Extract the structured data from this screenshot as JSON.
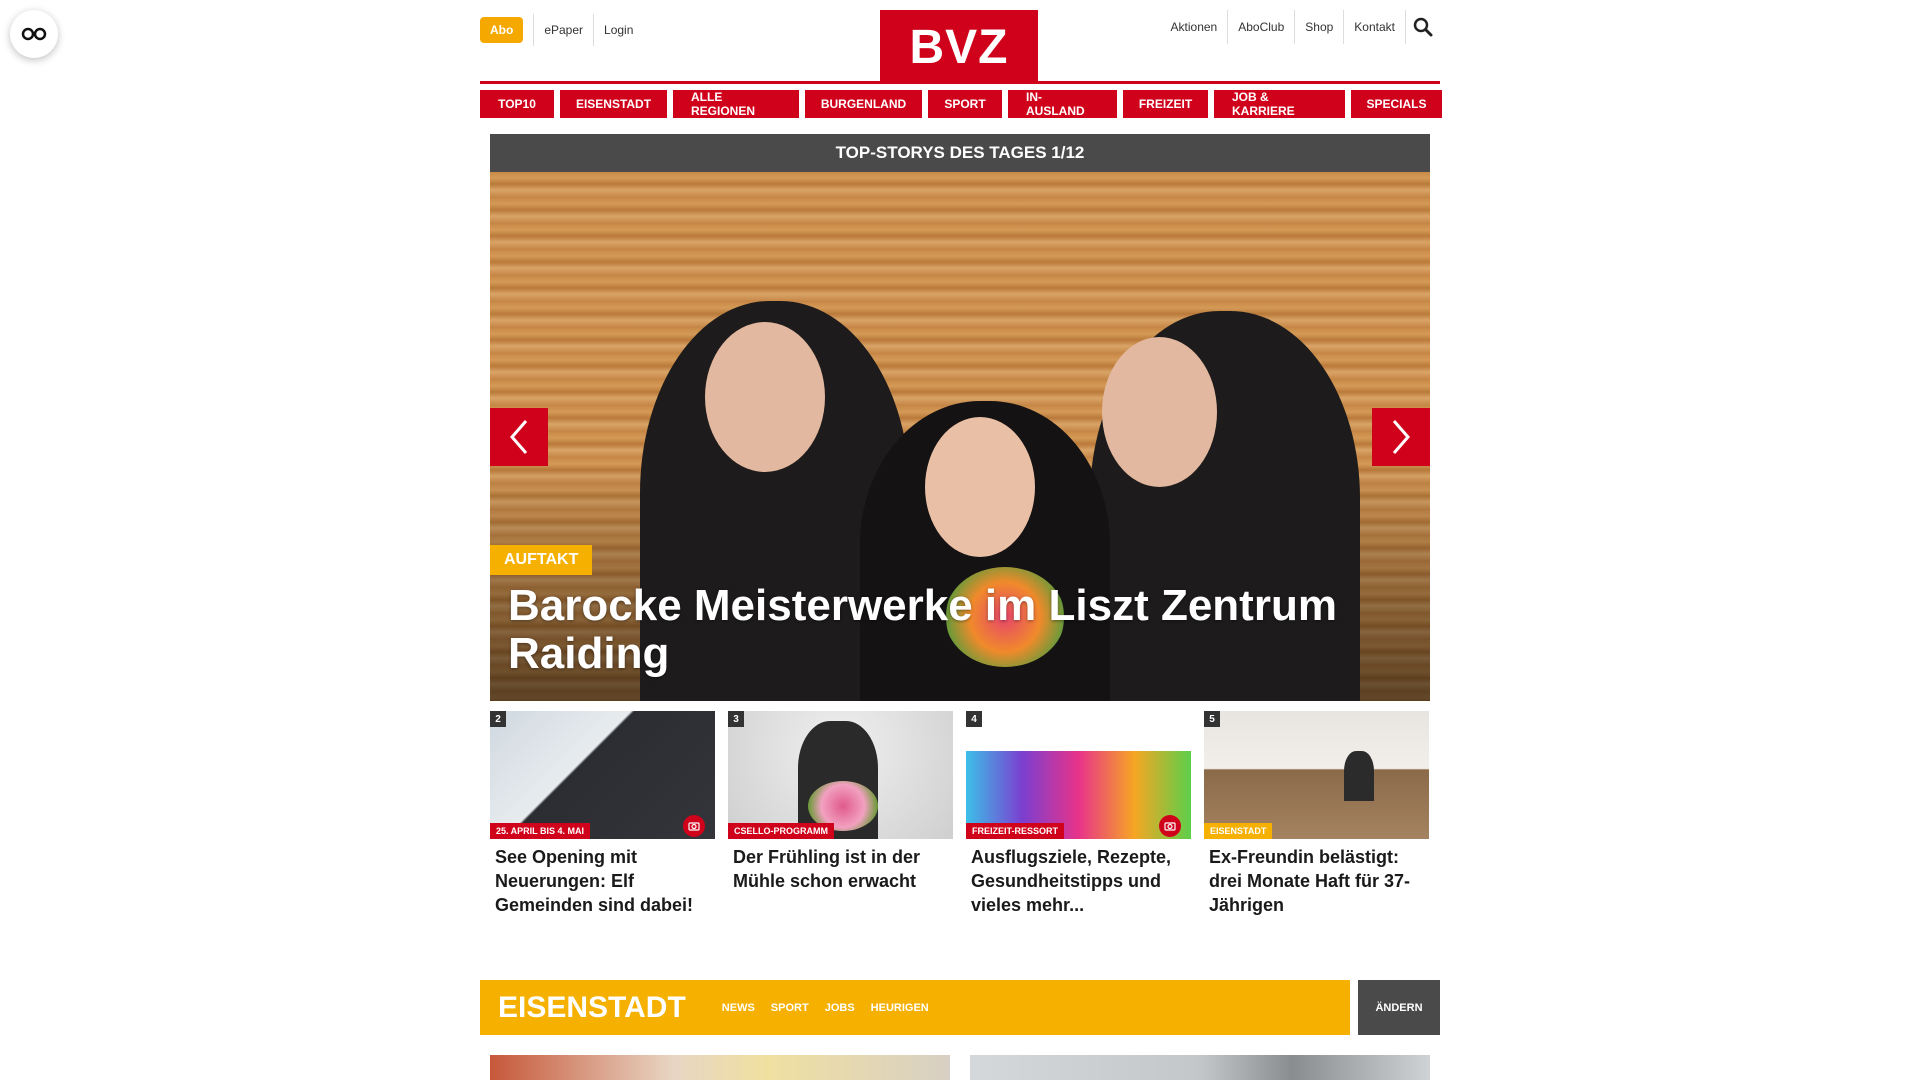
{
  "header": {
    "abo_label": "Abo",
    "epaper_label": "ePaper",
    "login_label": "Login",
    "logo_text": "BVZ",
    "right_links": [
      "Aktionen",
      "AboClub",
      "Shop",
      "Kontakt"
    ]
  },
  "nav": {
    "items": [
      "TOP10",
      "EISENSTADT",
      "ALLE REGIONEN",
      "BURGENLAND",
      "SPORT",
      "IN-AUSLAND",
      "FREIZEIT",
      "JOB & KARRIERE",
      "SPECIALS"
    ]
  },
  "hero": {
    "heading": "TOP-STORYS DES TAGES 1/12",
    "kicker": "AUFTAKT",
    "title": "Barocke Meisterwerke im Liszt Zentrum Raiding"
  },
  "teasers": [
    {
      "num": "2",
      "badge": "25. APRIL BIS 4. MAI",
      "title": "See Opening mit Neuerungen: Elf Gemeinden sind dabei!"
    },
    {
      "num": "3",
      "badge": "CSELLO-PROGRAMM",
      "title": "Der Frühling ist in der Mühle schon erwacht"
    },
    {
      "num": "4",
      "badge": "FREIZEIT-RESSORT",
      "title": "Ausflugsziele, Rezepte, Gesundheitstipps und vieles mehr..."
    },
    {
      "num": "5",
      "badge": "EISENSTADT",
      "title": "Ex-Freundin belästigt: drei Monate Haft für 37-Jährigen"
    }
  ],
  "section": {
    "title": "EISENSTADT",
    "links": [
      "NEWS",
      "SPORT",
      "JOBS",
      "HEURIGEN"
    ],
    "change_label": "ÄNDERN"
  },
  "colors": {
    "brand_red": "#d0021b",
    "accent_yellow": "#f5b000",
    "dark_gray": "#4a4a4a"
  }
}
